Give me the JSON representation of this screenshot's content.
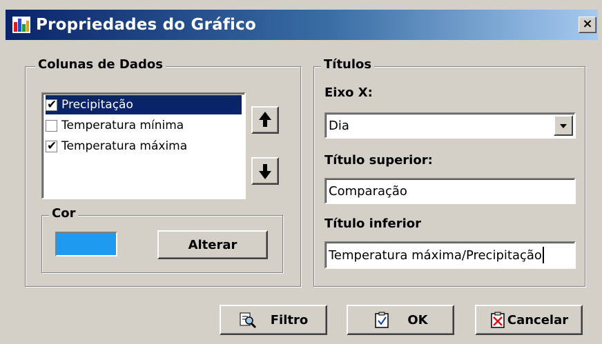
{
  "window": {
    "title": "Propriedades do Gráfico",
    "close_glyph": "×"
  },
  "data_columns": {
    "legend": "Colunas de Dados",
    "items": [
      {
        "label": "Precipitação",
        "checked": true,
        "selected": true
      },
      {
        "label": "Temperatura mínima",
        "checked": false,
        "selected": false
      },
      {
        "label": "Temperatura máxima",
        "checked": true,
        "selected": false
      }
    ],
    "move_up_icon": "arrow-up-icon",
    "move_down_icon": "arrow-down-icon"
  },
  "color": {
    "legend": "Cor",
    "value": "#1e9af0",
    "change_label": "Alterar"
  },
  "titles": {
    "legend": "Títulos",
    "x_axis_label": "Eixo X:",
    "x_axis_value": "Dia",
    "top_title_label": "Título superior:",
    "top_title_value": "Comparação",
    "bottom_title_label": "Título inferior",
    "bottom_title_value": "Temperatura máxima/Precipitação"
  },
  "footer": {
    "filter_label": "Filtro",
    "ok_label": "OK",
    "cancel_label": "Cancelar"
  },
  "colors": {
    "titlebar_start": "#0a246a",
    "titlebar_end": "#a6caf0",
    "selection": "#0a246a",
    "face": "#d4d0c8"
  }
}
